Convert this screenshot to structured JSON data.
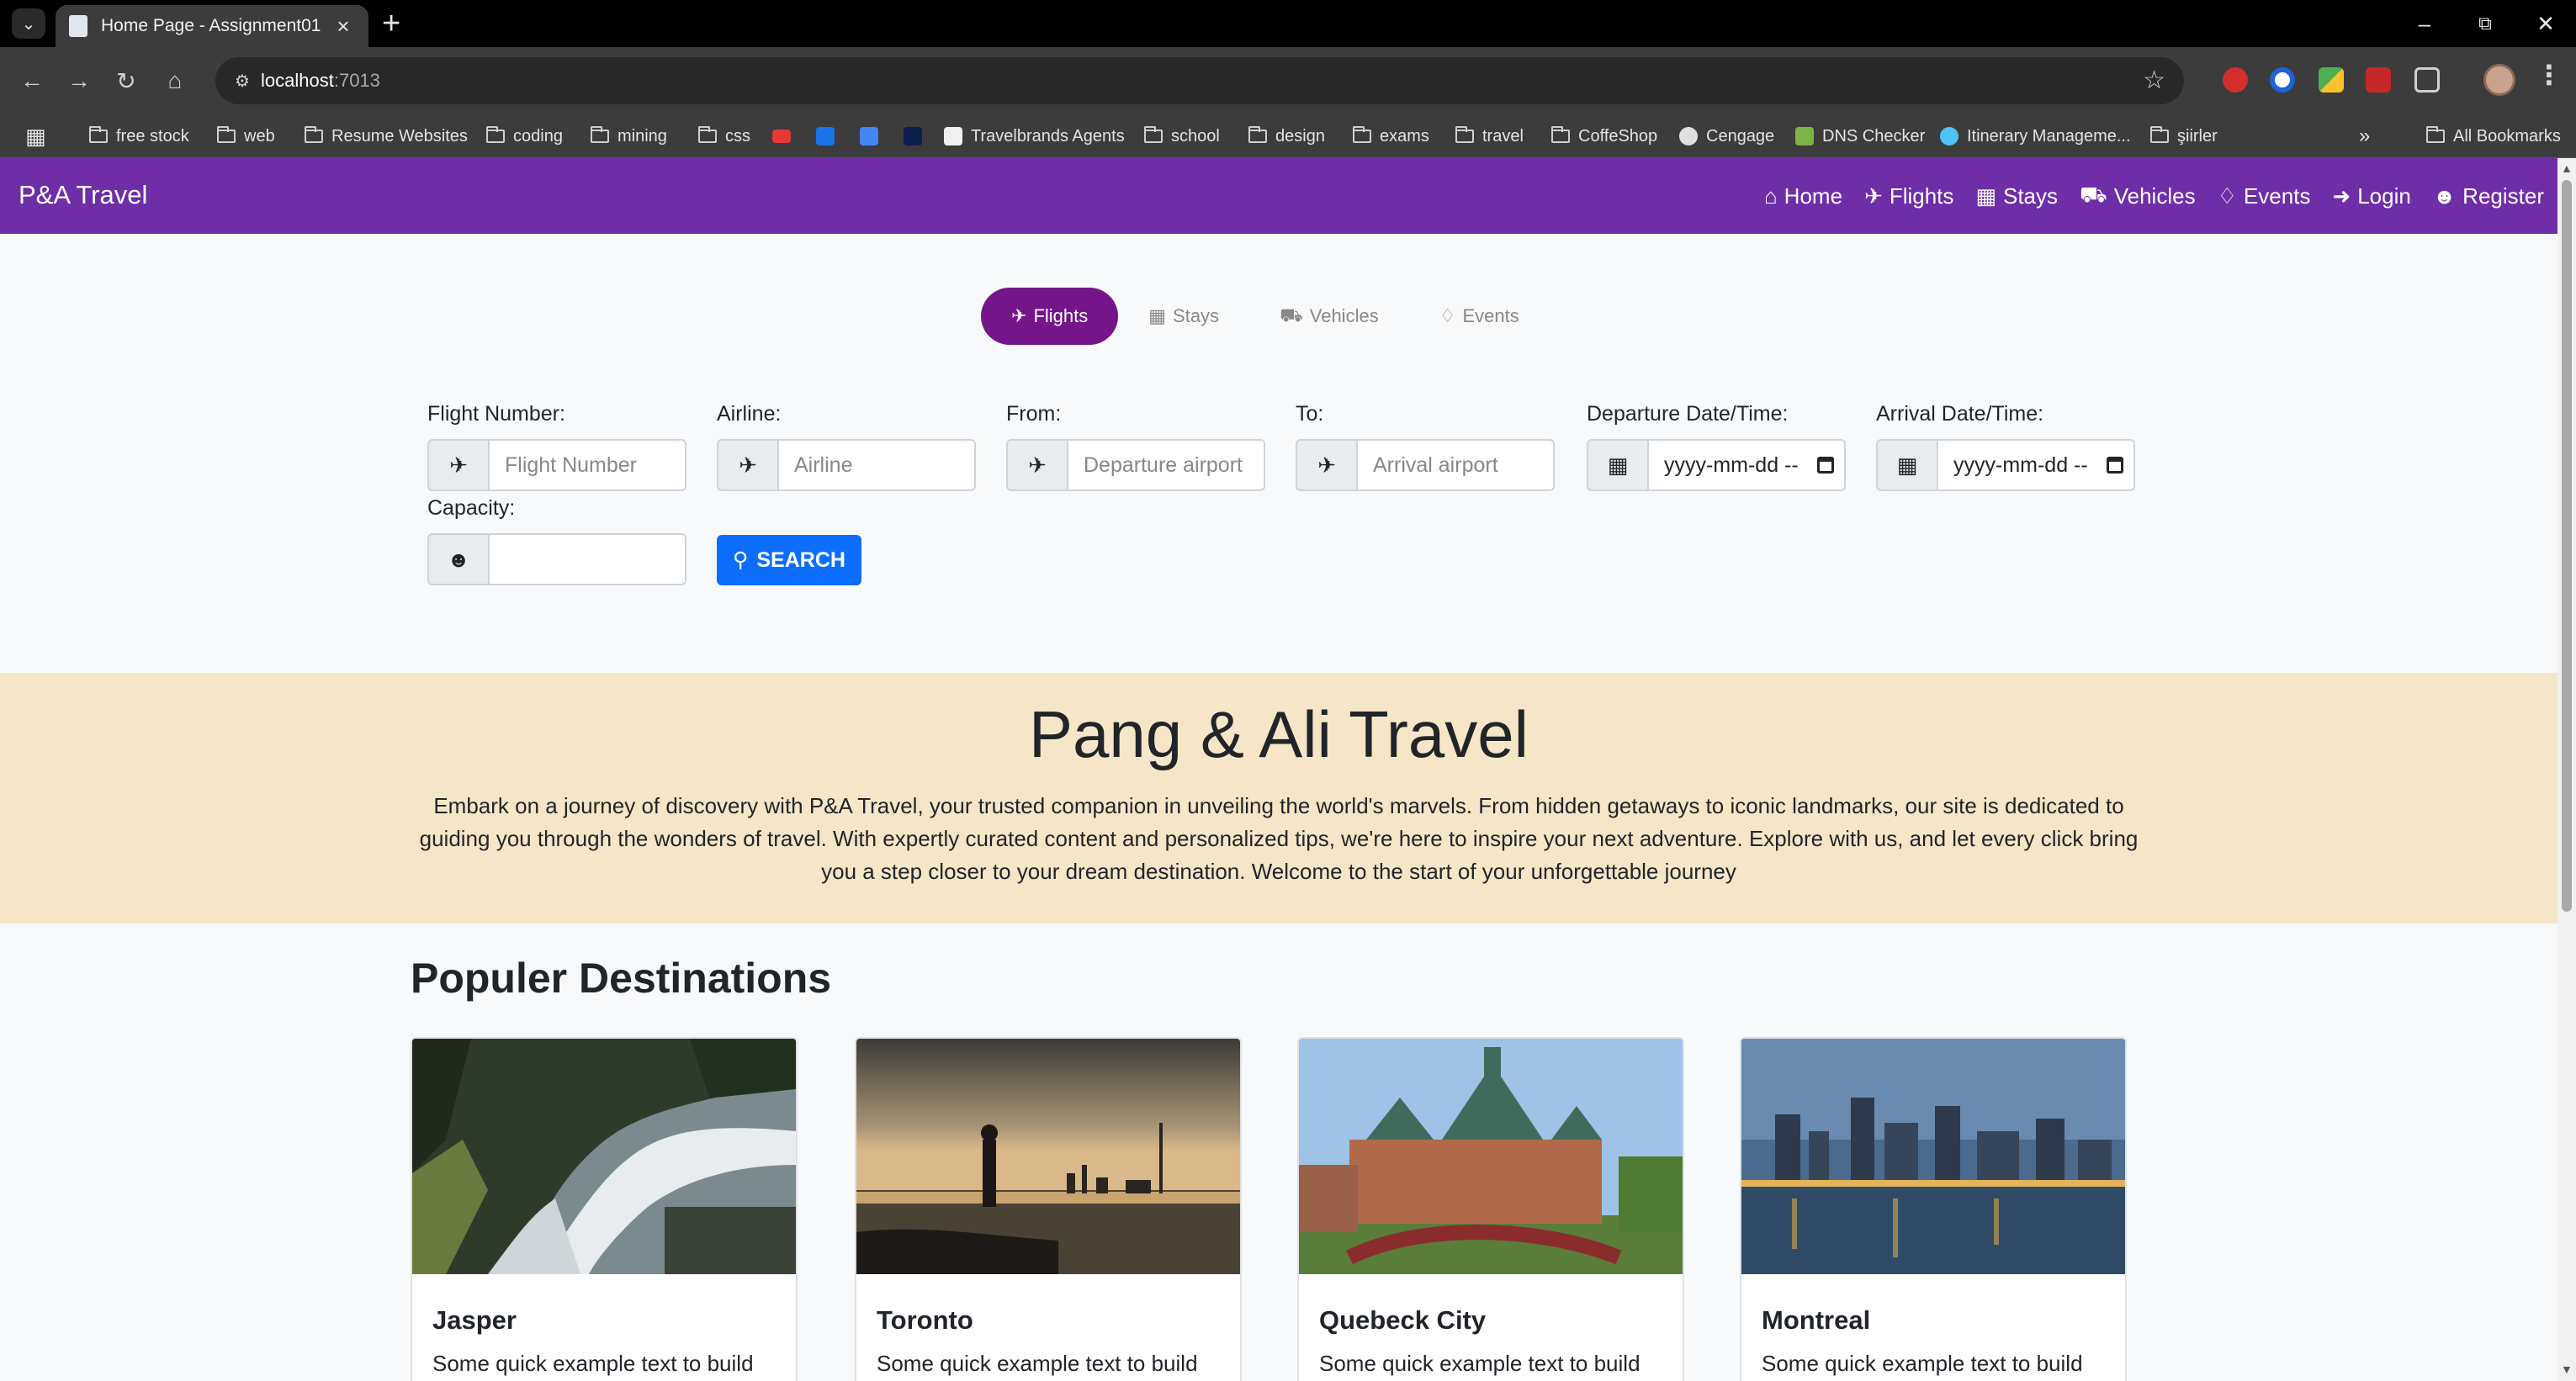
{
  "browser": {
    "tab_title": "Home Page - Assignment01",
    "url_host": "localhost",
    "url_port": ":7013",
    "bookmarks": [
      {
        "label": "free stock",
        "kind": "folder"
      },
      {
        "label": "web",
        "kind": "folder"
      },
      {
        "label": "Resume Websites",
        "kind": "folder"
      },
      {
        "label": "coding",
        "kind": "folder"
      },
      {
        "label": "mining",
        "kind": "folder"
      },
      {
        "label": "css",
        "kind": "folder"
      },
      {
        "label": "Travelbrands Agents",
        "kind": "site"
      },
      {
        "label": "school",
        "kind": "folder"
      },
      {
        "label": "design",
        "kind": "folder"
      },
      {
        "label": "exams",
        "kind": "folder"
      },
      {
        "label": "travel",
        "kind": "folder"
      },
      {
        "label": "CoffeShop",
        "kind": "folder"
      },
      {
        "label": "Cengage",
        "kind": "site"
      },
      {
        "label": "DNS Checker",
        "kind": "site"
      },
      {
        "label": "Itinerary Manageme...",
        "kind": "site"
      },
      {
        "label": "şiirler",
        "kind": "folder"
      }
    ],
    "all_bookmarks": "All Bookmarks"
  },
  "navbar": {
    "brand": "P&A Travel",
    "links": [
      "Home",
      "Flights",
      "Stays",
      "Vehicles",
      "Events",
      "Login",
      "Register"
    ],
    "color": "#6f2da8"
  },
  "search_tabs": {
    "tabs": [
      "Flights",
      "Stays",
      "Vehicles",
      "Events"
    ],
    "active": "Flights",
    "active_color": "#74168a"
  },
  "search_form": {
    "flight_number": {
      "label": "Flight Number:",
      "placeholder": "Flight Number"
    },
    "airline": {
      "label": "Airline:",
      "placeholder": "Airline"
    },
    "from": {
      "label": "From:",
      "placeholder": "Departure airport"
    },
    "to": {
      "label": "To:",
      "placeholder": "Arrival airport"
    },
    "departure": {
      "label": "Departure Date/Time:",
      "value": "yyyy-mm-dd --"
    },
    "arrival": {
      "label": "Arrival Date/Time:",
      "value": "yyyy-mm-dd --"
    },
    "capacity": {
      "label": "Capacity:",
      "value": ""
    },
    "search_button": "SEARCH",
    "button_color": "#0d6efd"
  },
  "hero": {
    "title": "Pang & Ali Travel",
    "text": "Embark on a journey of discovery with P&A Travel, your trusted companion in unveiling the world's marvels. From hidden getaways to iconic landmarks, our site is dedicated to guiding you through the wonders of travel. With expertly curated content and personalized tips, we're here to inspire your next adventure. Explore with us, and let every click bring you a step closer to your dream destination. Welcome to the start of your unforgettable journey",
    "background": "#f5e6c8"
  },
  "destinations": {
    "title": "Populer Destinations",
    "cards": [
      {
        "title": "Jasper",
        "text": "Some quick example text to build"
      },
      {
        "title": "Toronto",
        "text": "Some quick example text to build"
      },
      {
        "title": "Quebeck City",
        "text": "Some quick example text to build"
      },
      {
        "title": "Montreal",
        "text": "Some quick example text to build"
      }
    ]
  }
}
